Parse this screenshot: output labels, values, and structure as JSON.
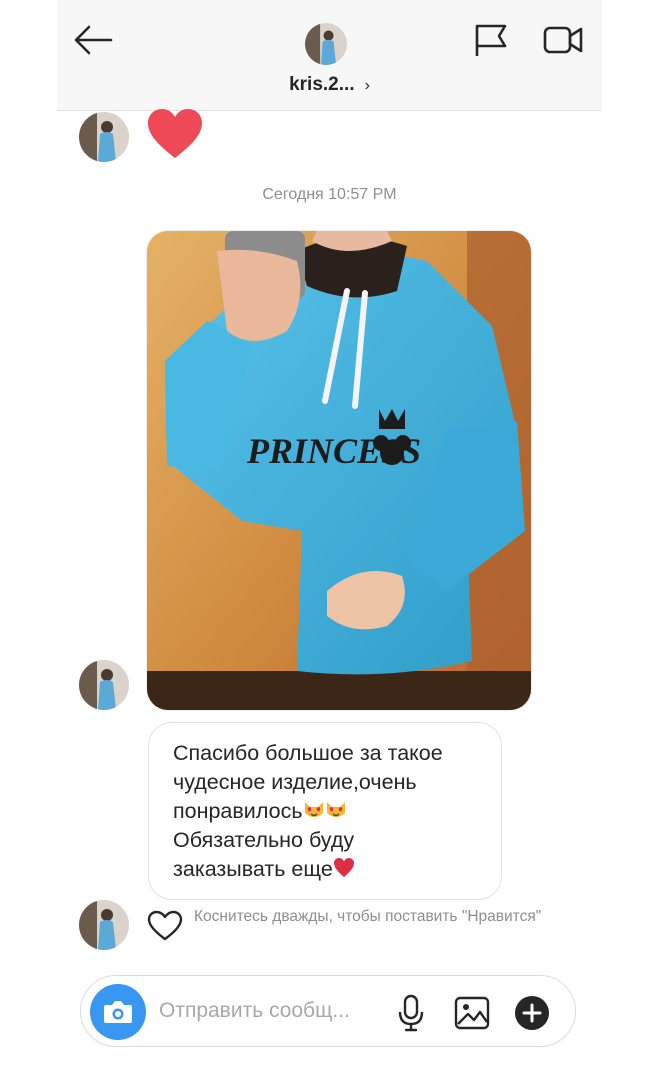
{
  "header": {
    "username": "kris.2...",
    "chevron": "›",
    "icons": [
      "back-arrow-icon",
      "flag-icon",
      "video-camera-icon"
    ]
  },
  "thread": {
    "reaction_icon": "red-heart-icon",
    "timestamp": "Сегодня 10:57 PM",
    "photo_print": "PRINCESS",
    "message_lines": [
      "Спасибо большое за такое",
      "чудесное изделие,очень",
      "понравилось",
      "Обязательно буду",
      "заказывать еще"
    ],
    "message_emojis": [
      "heart-eyes-cat-emoji",
      "heart-eyes-cat-emoji",
      "red-heart-emoji"
    ],
    "like_hint": "Коснитесь дважды, чтобы поставить \"Нравится\""
  },
  "composer": {
    "placeholder": "Отправить сообщ...",
    "icons": [
      "camera-icon",
      "microphone-icon",
      "gallery-icon",
      "plus-icon"
    ]
  },
  "colors": {
    "accent": "#3897f0",
    "heart": "#ed4956",
    "hoodie": "#3fb2de",
    "muted_text": "#8e8e8e"
  }
}
